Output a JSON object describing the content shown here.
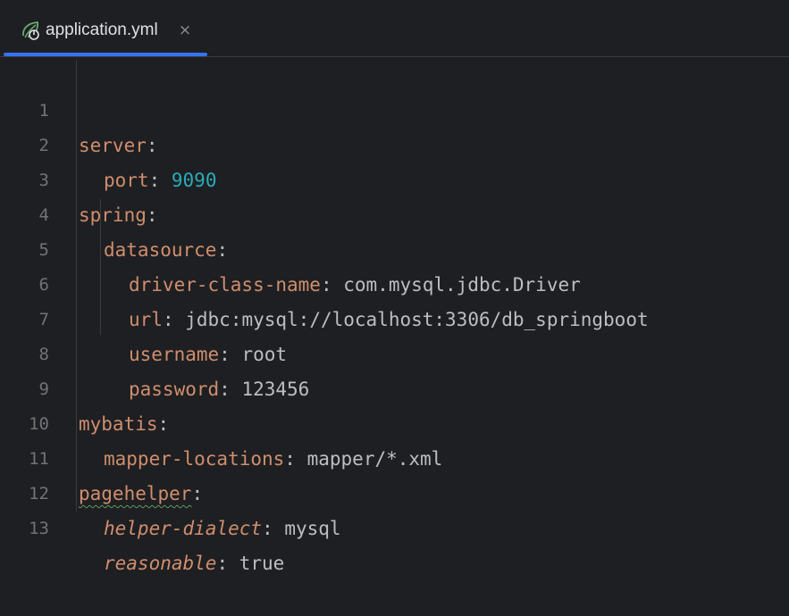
{
  "tab": {
    "label": "application.yml",
    "close": "×",
    "icon": "spring-leaf-icon"
  },
  "colors": {
    "background": "#1e1f22",
    "key": "#cf8e6d",
    "number": "#2aacb8",
    "text": "#bcbec4",
    "line_number": "#6f737a",
    "tab_accent": "#3574f0"
  },
  "lines": [
    {
      "num": "1",
      "key": "server",
      "colon": ":",
      "value": ""
    },
    {
      "num": "2",
      "key": "port",
      "colon": ":",
      "value": "9090"
    },
    {
      "num": "3",
      "key": "spring",
      "colon": ":",
      "value": ""
    },
    {
      "num": "4",
      "key": "datasource",
      "colon": ":",
      "value": ""
    },
    {
      "num": "5",
      "key": "driver-class-name",
      "colon": ":",
      "value": "com.mysql.jdbc.Driver"
    },
    {
      "num": "6",
      "key": "url",
      "colon": ":",
      "value": "jdbc:mysql://localhost:3306/db_springboot"
    },
    {
      "num": "7",
      "key": "username",
      "colon": ":",
      "value": "root"
    },
    {
      "num": "8",
      "key": "password",
      "colon": ":",
      "value": "123456"
    },
    {
      "num": "9",
      "key": "mybatis",
      "colon": ":",
      "value": ""
    },
    {
      "num": "10",
      "key": "mapper-locations",
      "colon": ":",
      "value": "mapper/*.xml"
    },
    {
      "num": "11",
      "key": "pagehelper",
      "colon": ":",
      "value": ""
    },
    {
      "num": "12",
      "key": "helper-dialect",
      "colon": ":",
      "value": "mysql"
    },
    {
      "num": "13",
      "key": "reasonable",
      "colon": ":",
      "value": "true"
    }
  ]
}
